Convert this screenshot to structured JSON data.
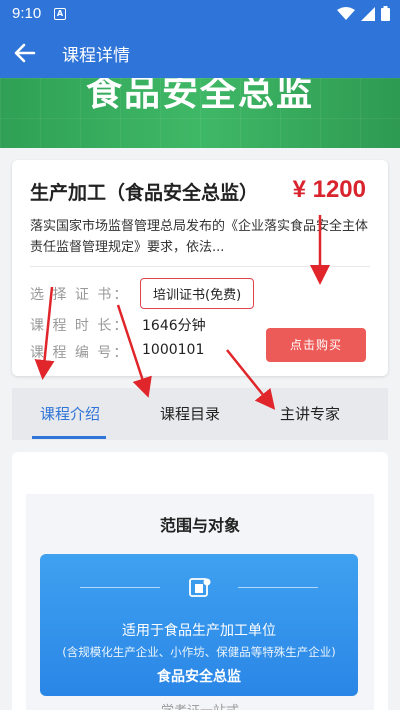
{
  "status": {
    "time": "9:10",
    "notif_letter": "A"
  },
  "appbar": {
    "title": "课程详情"
  },
  "banner": {
    "title": "食品安全总监"
  },
  "course": {
    "title": "生产加工（食品安全总监）",
    "price": "¥ 1200",
    "description": "落实国家市场监督管理总局发布的《企业落实食品安全主体责任监督管理规定》要求，依法...",
    "fields": {
      "cert_label": "选 择 证 书：",
      "cert_value": "培训证书(免费)",
      "duration_label": "课 程 时 长：",
      "duration_value": "1646分钟",
      "code_label": "课 程 编 号：",
      "code_value": "1000101"
    },
    "buy_label": "点击购买"
  },
  "tabs": [
    {
      "label": "课程介绍",
      "active": true
    },
    {
      "label": "课程目录",
      "active": false
    },
    {
      "label": "主讲专家",
      "active": false
    }
  ],
  "content": {
    "section_title": "范围与对象",
    "scope": {
      "line1": "适用于食品生产加工单位",
      "line2": "(含规模化生产企业、小作坊、保健品等特殊生产企业)",
      "line3": "食品安全总监"
    },
    "cut_text": "学考证一站式"
  },
  "colors": {
    "primary": "#2f74d8",
    "price": "#d9232d",
    "buy": "#ec5b57",
    "banner": "#3fb866",
    "annotation": "#e0262b"
  }
}
